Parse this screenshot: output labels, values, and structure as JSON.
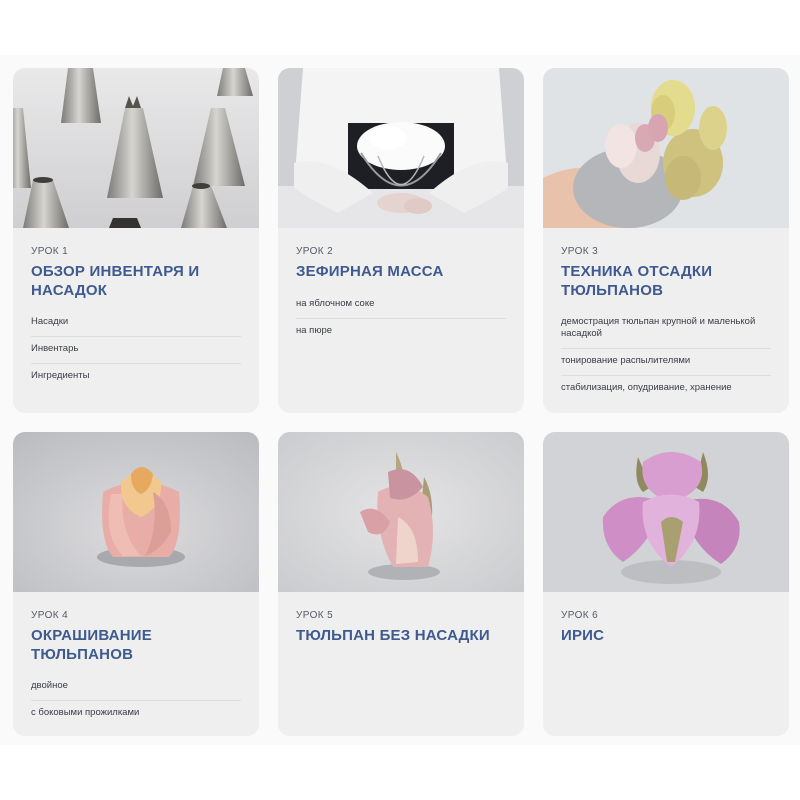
{
  "lessons": [
    {
      "label": "УРОК 1",
      "title": "ОБЗОР ИНВЕНТАРЯ И НАСАДОК",
      "photo": "piping-nozzles-image",
      "topics": [
        "Насадки",
        "Инвентарь",
        "Ингредиенты"
      ]
    },
    {
      "label": "УРОК 2",
      "title": "ЗЕФИРНАЯ МАССА",
      "photo": "marshmallow-mass-image",
      "topics": [
        "на яблочном соке",
        "на пюре"
      ]
    },
    {
      "label": "УРОК 3",
      "title": "ТЕХНИКА ОТСАДКИ ТЮЛЬПАНОВ",
      "photo": "tulip-piping-image",
      "topics": [
        "демострация тюльпан крупной и маленькой насадкой",
        "тонирование распылителями",
        "стабилизация, опудривание, хранение"
      ]
    },
    {
      "label": "УРОК 4",
      "title": "ОКРАШИВАНИЕ ТЮЛЬПАНОВ",
      "photo": "colored-tulip-image",
      "topics": [
        "двойное",
        "с боковыми прожилками"
      ]
    },
    {
      "label": "УРОК 5",
      "title": "ТЮЛЬПАН БЕЗ НАСАДКИ",
      "photo": "tulip-without-nozzle-image",
      "topics": []
    },
    {
      "label": "УРОК 6",
      "title": "ИРИС",
      "photo": "iris-flower-image",
      "topics": []
    }
  ],
  "colors": {
    "card_bg": "#efeff0",
    "title": "#3e5a8e",
    "text": "#3a3d44"
  }
}
